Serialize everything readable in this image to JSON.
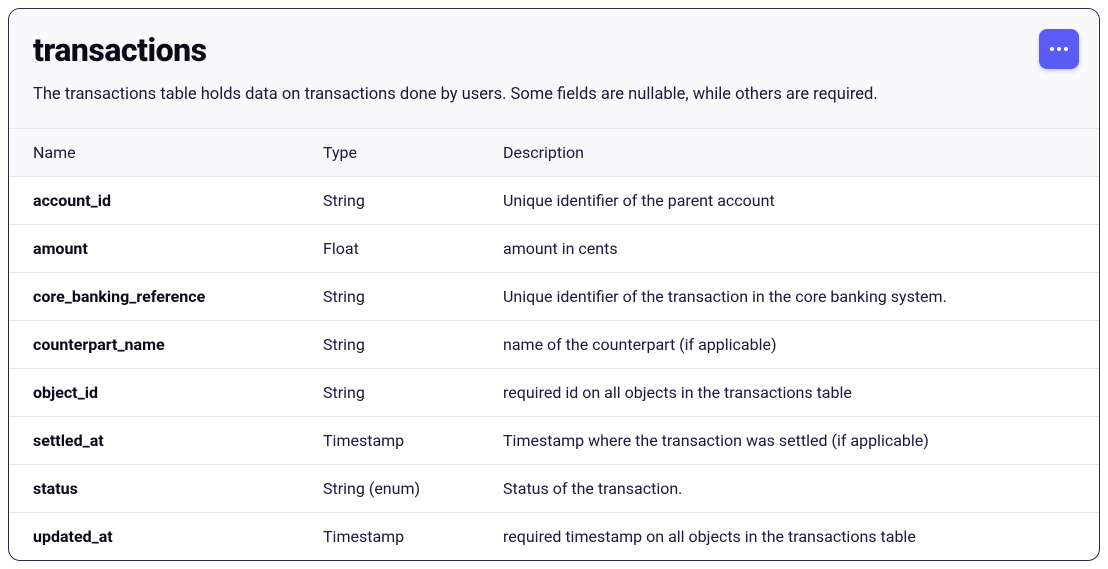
{
  "header": {
    "title": "transactions",
    "description": "The transactions table holds data on transactions done by users. Some fields are nullable, while others are required."
  },
  "columns": {
    "name": "Name",
    "type": "Type",
    "description": "Description"
  },
  "rows": [
    {
      "name": "account_id",
      "type": "String",
      "description": "Unique identifier of the parent account"
    },
    {
      "name": "amount",
      "type": "Float",
      "description": "amount in cents"
    },
    {
      "name": "core_banking_reference",
      "type": "String",
      "description": "Unique identifier of the transaction in the core banking system."
    },
    {
      "name": "counterpart_name",
      "type": "String",
      "description": "name of the counterpart (if applicable)"
    },
    {
      "name": "object_id",
      "type": "String",
      "description": "required id on all objects in the transactions table"
    },
    {
      "name": "settled_at",
      "type": "Timestamp",
      "description": "Timestamp where the transaction was settled (if applicable)"
    },
    {
      "name": "status",
      "type": "String (enum)",
      "description": "Status of the transaction."
    },
    {
      "name": "updated_at",
      "type": "Timestamp",
      "description": "required timestamp on all objects in the transactions table"
    }
  ]
}
